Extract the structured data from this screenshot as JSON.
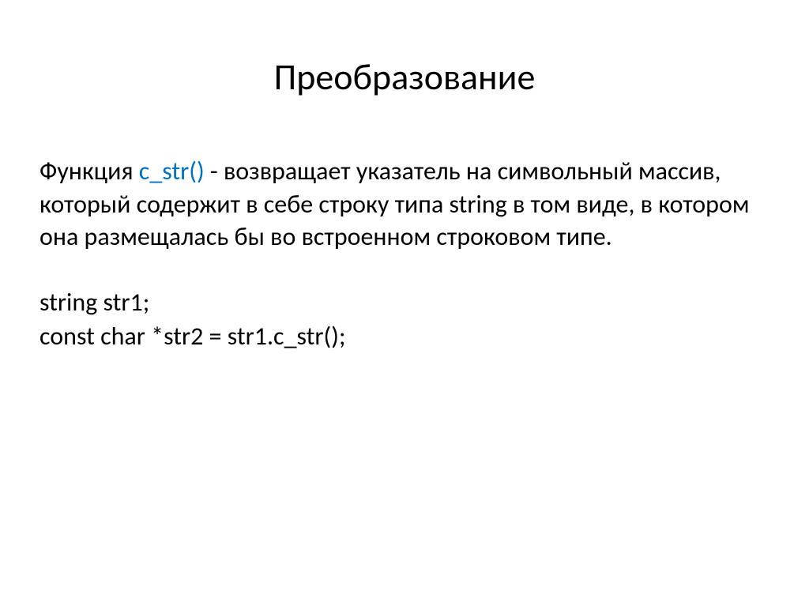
{
  "title": "Преобразование",
  "paragraph": {
    "prefix": "Функция ",
    "highlighted": "с_str()",
    "suffix": " -  возвращает указатель на символьный массив, который содержит в себе строку типа string в том виде, в котором она размещалась бы во встроенном строковом типе."
  },
  "code": {
    "line1": "string str1;",
    "line2": "const char *str2 = str1.c_str();"
  }
}
